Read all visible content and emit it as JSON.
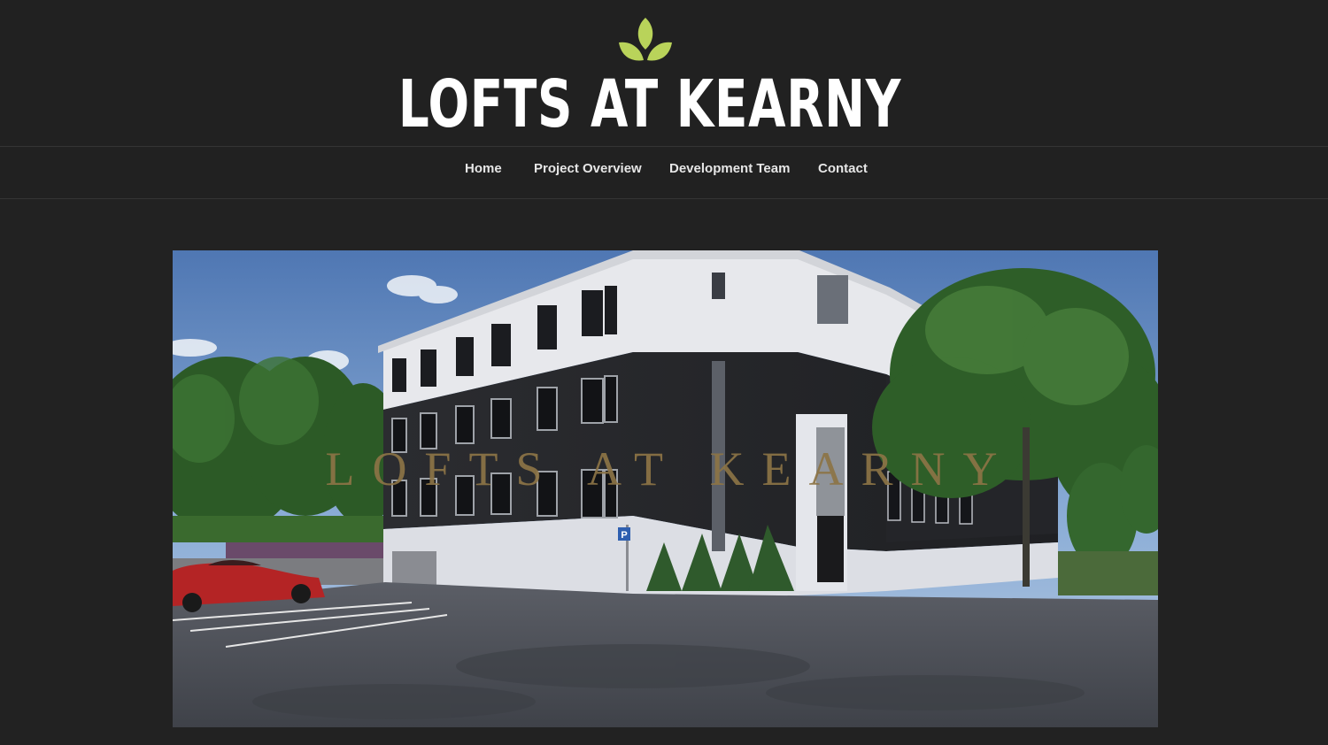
{
  "site": {
    "title": "LOFTS AT KEARNY",
    "logo_icon": "leaf-sprout-icon",
    "accent_color": "#b9d35a",
    "background_color": "#212121"
  },
  "nav": {
    "items": [
      {
        "label": "Home"
      },
      {
        "label": "Project Overview"
      },
      {
        "label": "Development Team"
      },
      {
        "label": "Contact"
      }
    ]
  },
  "hero": {
    "overlay_title": "LOFTS AT KEARNY",
    "overlay_color": "#8c7446",
    "parking_sign": "P"
  }
}
